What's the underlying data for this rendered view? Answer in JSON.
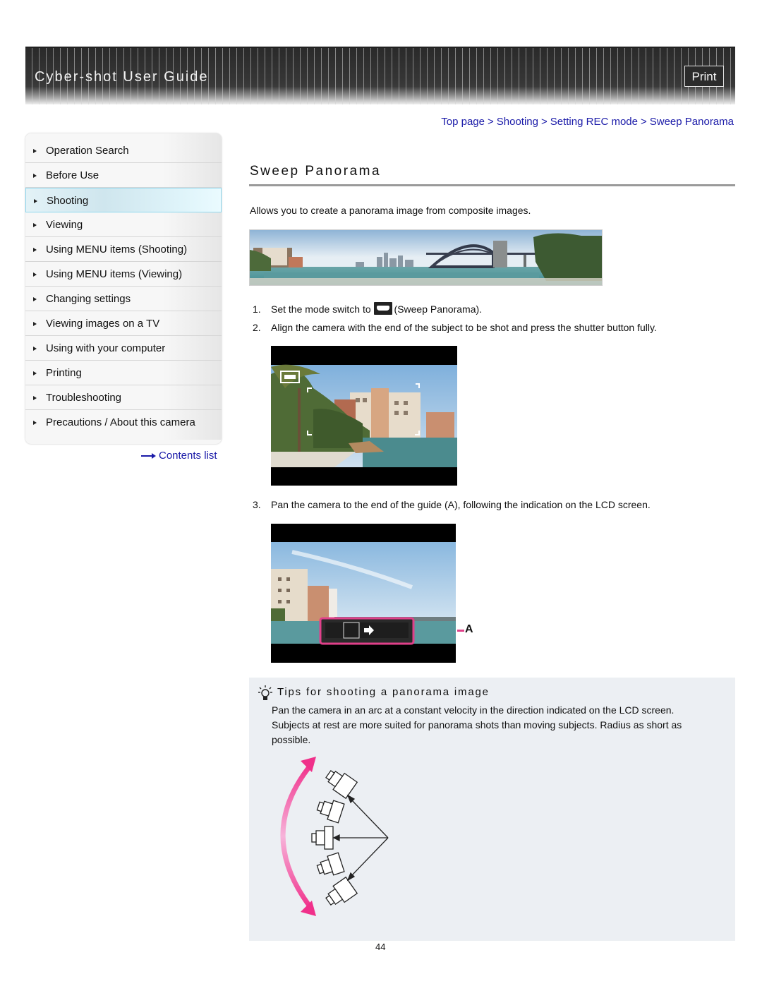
{
  "header": {
    "title": "Cyber-shot User Guide",
    "print_label": "Print"
  },
  "sidebar": {
    "items": [
      {
        "label": "Operation Search",
        "active": false
      },
      {
        "label": "Before Use",
        "active": false
      },
      {
        "label": "Shooting",
        "active": true
      },
      {
        "label": "Viewing",
        "active": false
      },
      {
        "label": "Using MENU items (Shooting)",
        "active": false
      },
      {
        "label": "Using MENU items (Viewing)",
        "active": false
      },
      {
        "label": "Changing settings",
        "active": false
      },
      {
        "label": "Viewing images on a TV",
        "active": false
      },
      {
        "label": "Using with your computer",
        "active": false
      },
      {
        "label": "Printing",
        "active": false
      },
      {
        "label": "Troubleshooting",
        "active": false
      },
      {
        "label": "Precautions / About this camera",
        "active": false
      }
    ],
    "contents_link": "Contents list"
  },
  "breadcrumb": {
    "items": [
      "Top page",
      "Shooting",
      "Setting REC mode",
      "Sweep Panorama"
    ],
    "separator": ">"
  },
  "main": {
    "title": "Sweep Panorama",
    "intro": "Allows you to create a panorama image from composite images.",
    "panorama_alt": "Panorama of harbour with arch bridge and city skyline",
    "steps": [
      {
        "num": "1.",
        "text_before": "Set the mode switch to",
        "icon": "sweep-panorama-mode-icon",
        "text_after": "(Sweep Panorama)."
      },
      {
        "num": "2.",
        "text": "Align the camera with the end of the subject to be shot and press the shutter button fully."
      },
      {
        "num": "3.",
        "text": "Pan the camera to the end of the guide (A), following the indication on the LCD screen."
      }
    ],
    "guide_label": "A"
  },
  "tips": {
    "icon": "lightbulb-icon",
    "title": "Tips for shooting a panorama image",
    "text": "Pan the camera in an arc at a constant velocity in the direction indicated on the LCD screen. Subjects at rest are more suited for panorama shots than moving subjects. Radius as short as possible."
  },
  "footer": {
    "page_number": "44"
  },
  "colors": {
    "link": "#1a1aa8",
    "active_nav": "#cfe6ee",
    "guide_highlight": "#e0408a",
    "tips_bg": "#eceff3"
  }
}
